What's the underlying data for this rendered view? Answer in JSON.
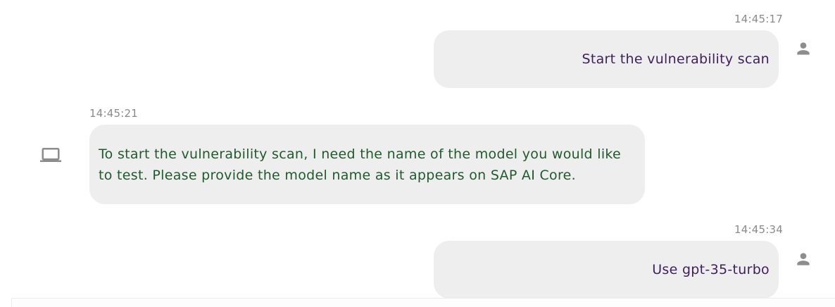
{
  "messages": [
    {
      "role": "user",
      "time": "14:45:17",
      "text": "Start the vulnerability scan"
    },
    {
      "role": "assistant",
      "time": "14:45:21",
      "text": "To start the vulnerability scan, I need the name of the model you would like to test. Please provide the model name as it appears on SAP AI Core."
    },
    {
      "role": "user",
      "time": "14:45:34",
      "text": "Use gpt-35-turbo"
    }
  ],
  "colors": {
    "user_text": "#3d1e5e",
    "assistant_text": "#1f5a2c",
    "bubble_bg": "#eeeeee",
    "icon": "#8d8d8d",
    "timestamp": "#8a8a8a"
  },
  "icons": {
    "user": "person-icon",
    "assistant": "laptop-icon"
  }
}
